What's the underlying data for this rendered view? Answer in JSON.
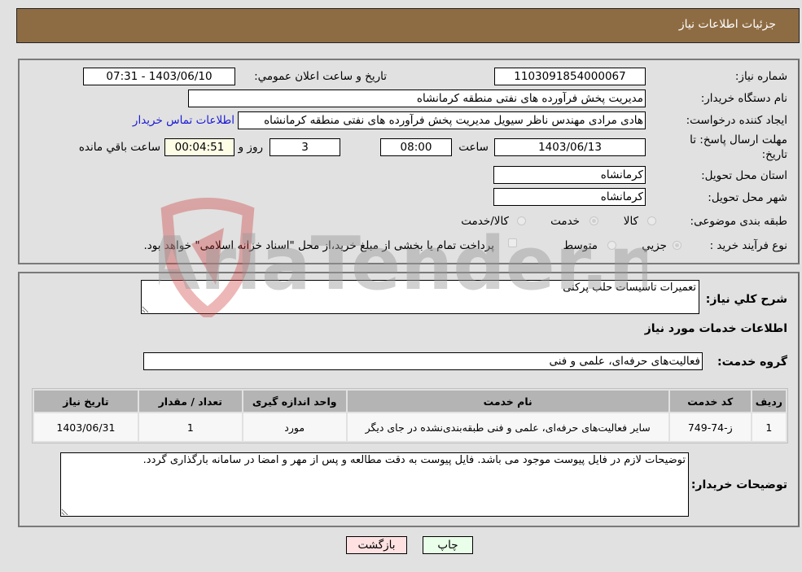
{
  "header": {
    "title": "جزئیات اطلاعات نیاز"
  },
  "info": {
    "need_number_label": "شماره نیاز:",
    "need_number": "1103091854000067",
    "announce_label": "تاریخ و ساعت اعلان عمومي:",
    "announce_value": "1403/06/10 - 07:31",
    "buyer_org_label": "نام دستگاه خريدار:",
    "buyer_org": "مديريت پخش فرآورده هاى نفتى منطقه كرمانشاه",
    "creator_label": "ايجاد كننده درخواست:",
    "creator": "هادى مرادى مهندس ناظر سيويل مديريت پخش فرآورده هاى نفتى منطقه كرمانشاه",
    "contact_link": "اطلاعات تماس خريدار",
    "deadline_label_line1": "مهلت ارسال پاسخ: تا",
    "deadline_label_line2": "تاريخ:",
    "deadline_date": "1403/06/13",
    "time_label": "ساعت",
    "deadline_time": "08:00",
    "days_value": "3",
    "days_label": "روز و",
    "remaining_time": "00:04:51",
    "remaining_label": "ساعت باقي مانده",
    "province_label": "استان محل تحويل:",
    "province": "كرمانشاه",
    "city_label": "شهر محل تحويل:",
    "city": "كرمانشاه",
    "category_label": "طبقه بندى موضوعى:",
    "category_options": [
      {
        "label": "كالا",
        "checked": false
      },
      {
        "label": "خدمت",
        "checked": true
      },
      {
        "label": "كالا/خدمت",
        "checked": false
      }
    ],
    "process_label": "نوع فرآيند خريد :",
    "process_options": [
      {
        "label": "جزيي",
        "checked": true
      },
      {
        "label": "متوسط",
        "checked": false
      }
    ],
    "payment_note": "پرداخت تمام يا بخشى از مبلغ خريد،از محل \"اسناد خزانه اسلامى\" خواهد بود."
  },
  "details": {
    "summary_label": "شرح كلي نياز:",
    "summary": "تعميرات تاسيسات حلب پركنى",
    "services_heading": "اطلاعات خدمات مورد نياز",
    "service_group_label": "گروه خدمت:",
    "service_group": "فعاليت‌هاى حرفه‌اى، علمى و فنى",
    "table": {
      "headers": [
        "رديف",
        "كد خدمت",
        "نام خدمت",
        "واحد اندازه گيرى",
        "تعداد / مقدار",
        "تاريخ نياز"
      ],
      "rows": [
        [
          "1",
          "ز-74-749",
          "ساير فعاليت‌هاى حرفه‌اى، علمى و فنى طبقه‌بندى‌نشده در جاى ديگر",
          "مورد",
          "1",
          "1403/06/31"
        ]
      ]
    },
    "buyer_notes_label": "توضيحات خريدار:",
    "buyer_notes": "توضيحات لازم در فايل پيوست موجود مى باشد. فايل پيوست به دقت مطالعه و پس از مهر و امضا در سامانه بارگذارى گردد."
  },
  "buttons": {
    "print": "چاپ",
    "back": "بازگشت"
  },
  "watermark": {
    "text": "AriaTender.neT"
  },
  "colors": {
    "header_bg": "#8e6c43",
    "print_bg": "#e9ffe9",
    "back_bg": "#ffe1e1",
    "link": "#1a1ad6"
  }
}
